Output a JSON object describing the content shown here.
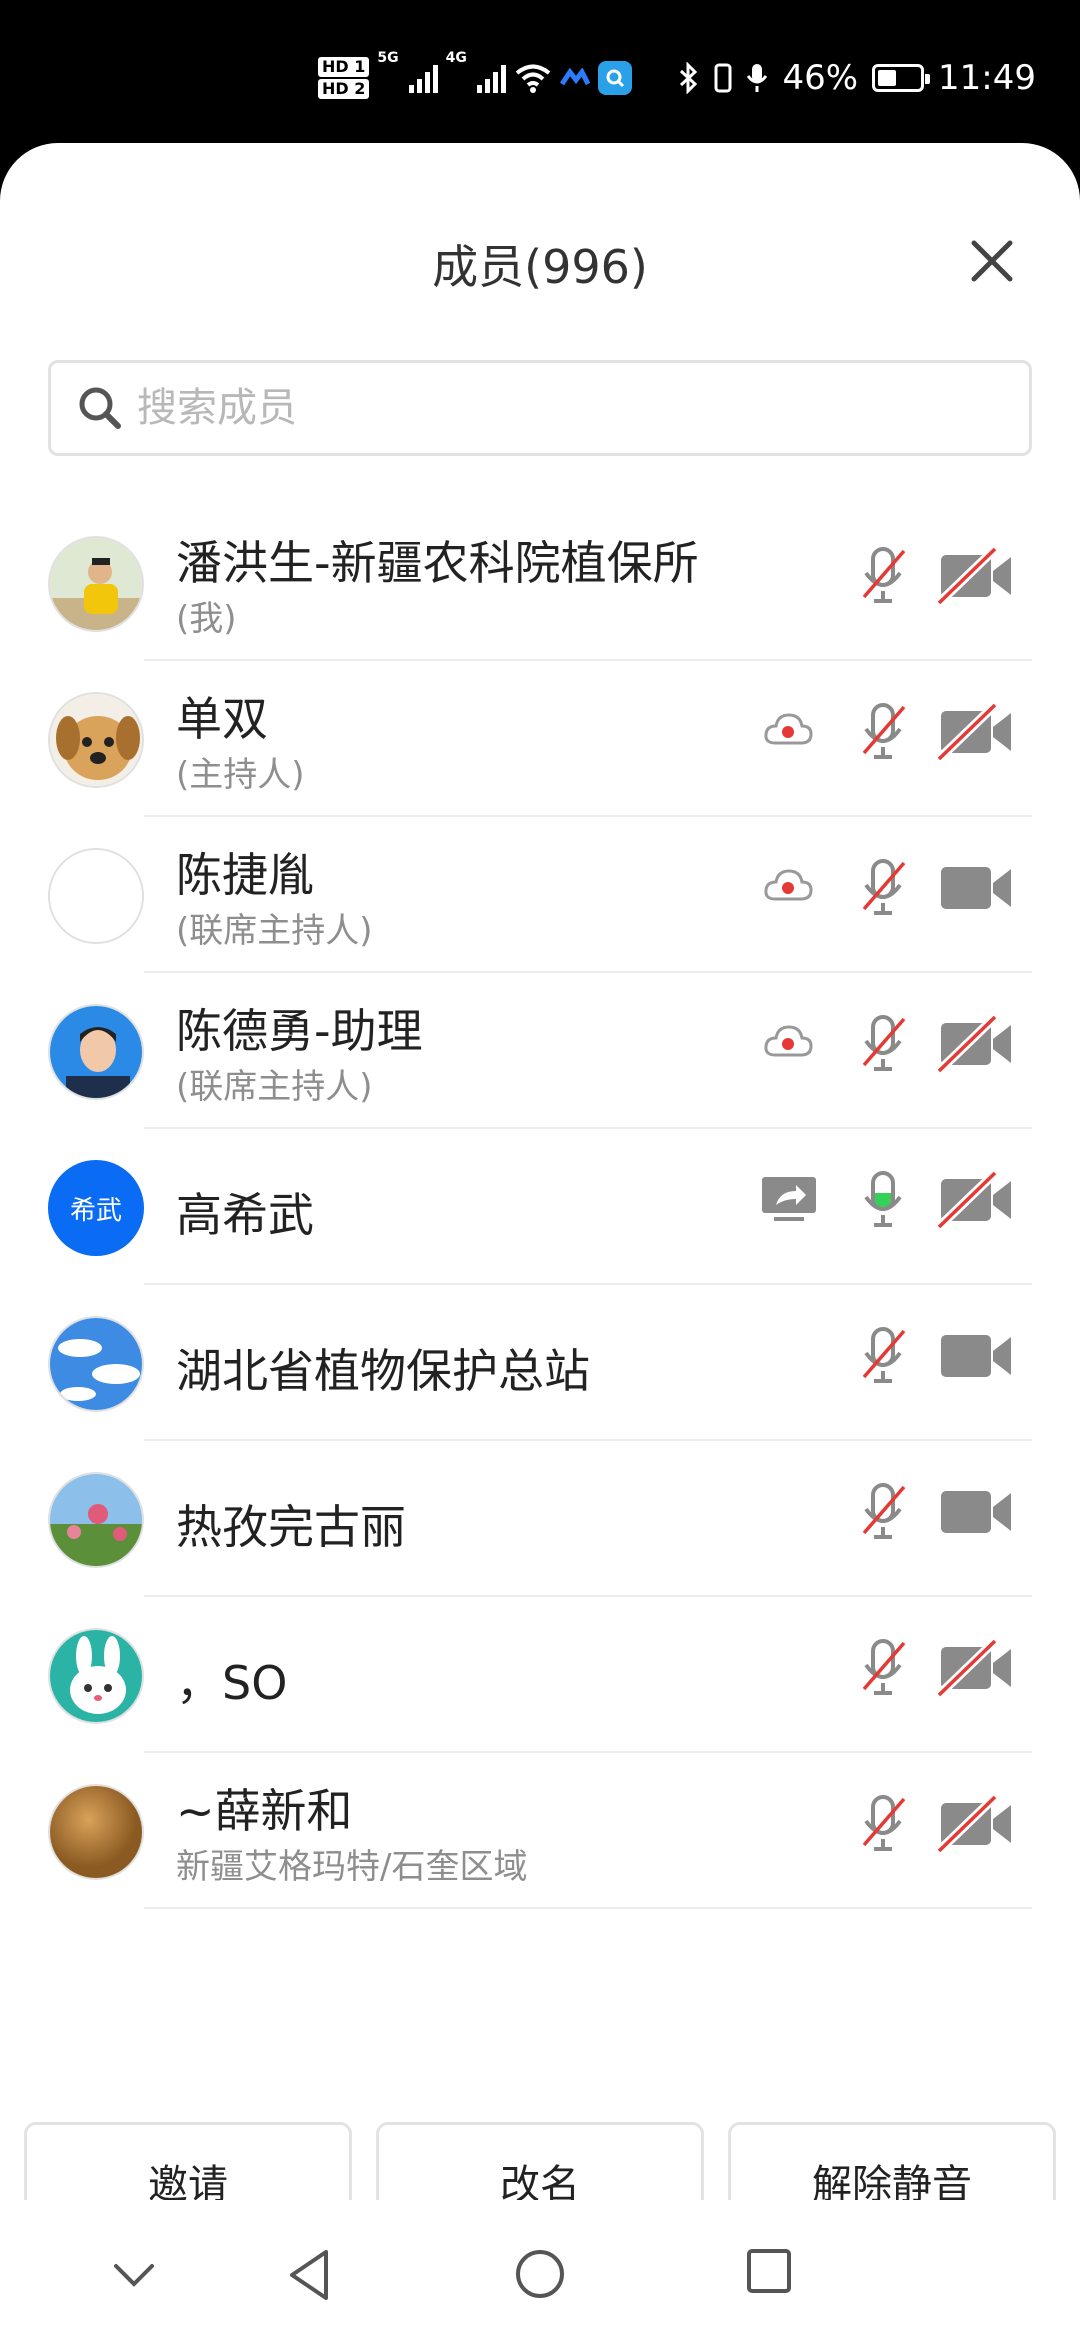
{
  "status": {
    "hd1": "HD 1",
    "hd2": "HD 2",
    "net1": "5G",
    "net2": "4G",
    "battery_percent": "46%",
    "battery_level": 0.46,
    "time": "11:49"
  },
  "header": {
    "title": "成员(996)",
    "close_icon": "close-icon"
  },
  "search": {
    "placeholder": "搜索成员",
    "value": ""
  },
  "members": [
    {
      "name": "潘洪生-新疆农科院植保所",
      "subtitle": "(我)",
      "avatar": "photo-person-yellow",
      "cloud_record": false,
      "screen_share": false,
      "mic": "muted",
      "camera": "off"
    },
    {
      "name": "单双",
      "subtitle": "(主持人)",
      "avatar": "photo-puppy",
      "cloud_record": true,
      "screen_share": false,
      "mic": "muted",
      "camera": "off"
    },
    {
      "name": "陈捷胤",
      "subtitle": "(联席主持人)",
      "avatar": "blank",
      "cloud_record": true,
      "screen_share": false,
      "mic": "muted",
      "camera": "on"
    },
    {
      "name": "陈德勇-助理",
      "subtitle": "(联席主持人)",
      "avatar": "photo-id-portrait",
      "cloud_record": true,
      "screen_share": false,
      "mic": "muted",
      "camera": "off"
    },
    {
      "name": "高希武",
      "subtitle": "",
      "avatar_text": "希武",
      "cloud_record": false,
      "screen_share": true,
      "mic": "active",
      "camera": "off"
    },
    {
      "name": "湖北省植物保护总站",
      "subtitle": "",
      "avatar": "photo-sky-clouds",
      "cloud_record": false,
      "screen_share": false,
      "mic": "muted",
      "camera": "on"
    },
    {
      "name": "热孜完古丽",
      "subtitle": "",
      "avatar": "photo-flowers",
      "cloud_record": false,
      "screen_share": false,
      "mic": "muted",
      "camera": "on"
    },
    {
      "name": "，SO",
      "subtitle": "",
      "avatar": "cartoon-rabbit",
      "cloud_record": false,
      "screen_share": false,
      "mic": "muted",
      "camera": "off"
    },
    {
      "name": "~薛新和",
      "subtitle": "新疆艾格玛特/石奎区域",
      "avatar": "brown-circle",
      "cloud_record": false,
      "screen_share": false,
      "mic": "muted",
      "camera": "off"
    }
  ],
  "actions": {
    "invite": "邀请",
    "rename": "改名",
    "unmute": "解除静音"
  },
  "colors": {
    "accent": "#0a6cf5",
    "mute_red": "#e53935",
    "record_red": "#e53935",
    "speaking_green": "#34d058",
    "icon_gray": "#8a8a8a"
  }
}
